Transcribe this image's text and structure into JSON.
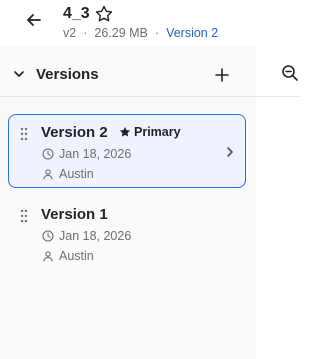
{
  "header": {
    "title": "4_3",
    "version_tag": "v2",
    "separator": "·",
    "size": "26.29 MB",
    "current_version_link": "Version 2"
  },
  "panel": {
    "title": "Versions"
  },
  "versions": [
    {
      "name": "Version 2",
      "badge": "Primary",
      "date": "Jan 18, 2026",
      "author": "Austin",
      "selected": true
    },
    {
      "name": "Version 1",
      "date": "Jan 18, 2026",
      "author": "Austin",
      "selected": false
    }
  ],
  "colors": {
    "accent": "#2f6fd8",
    "link": "#2563c9",
    "selected_bg": "#eef3fd",
    "panel_bg": "#fafafa",
    "muted_text": "#6b7075"
  },
  "icons": [
    "back-arrow-icon",
    "star-outline-icon",
    "chevron-down-icon",
    "plus-icon",
    "zoom-out-icon",
    "drag-handle-icon",
    "star-filled-icon",
    "clock-icon",
    "user-icon",
    "chevron-right-icon"
  ]
}
